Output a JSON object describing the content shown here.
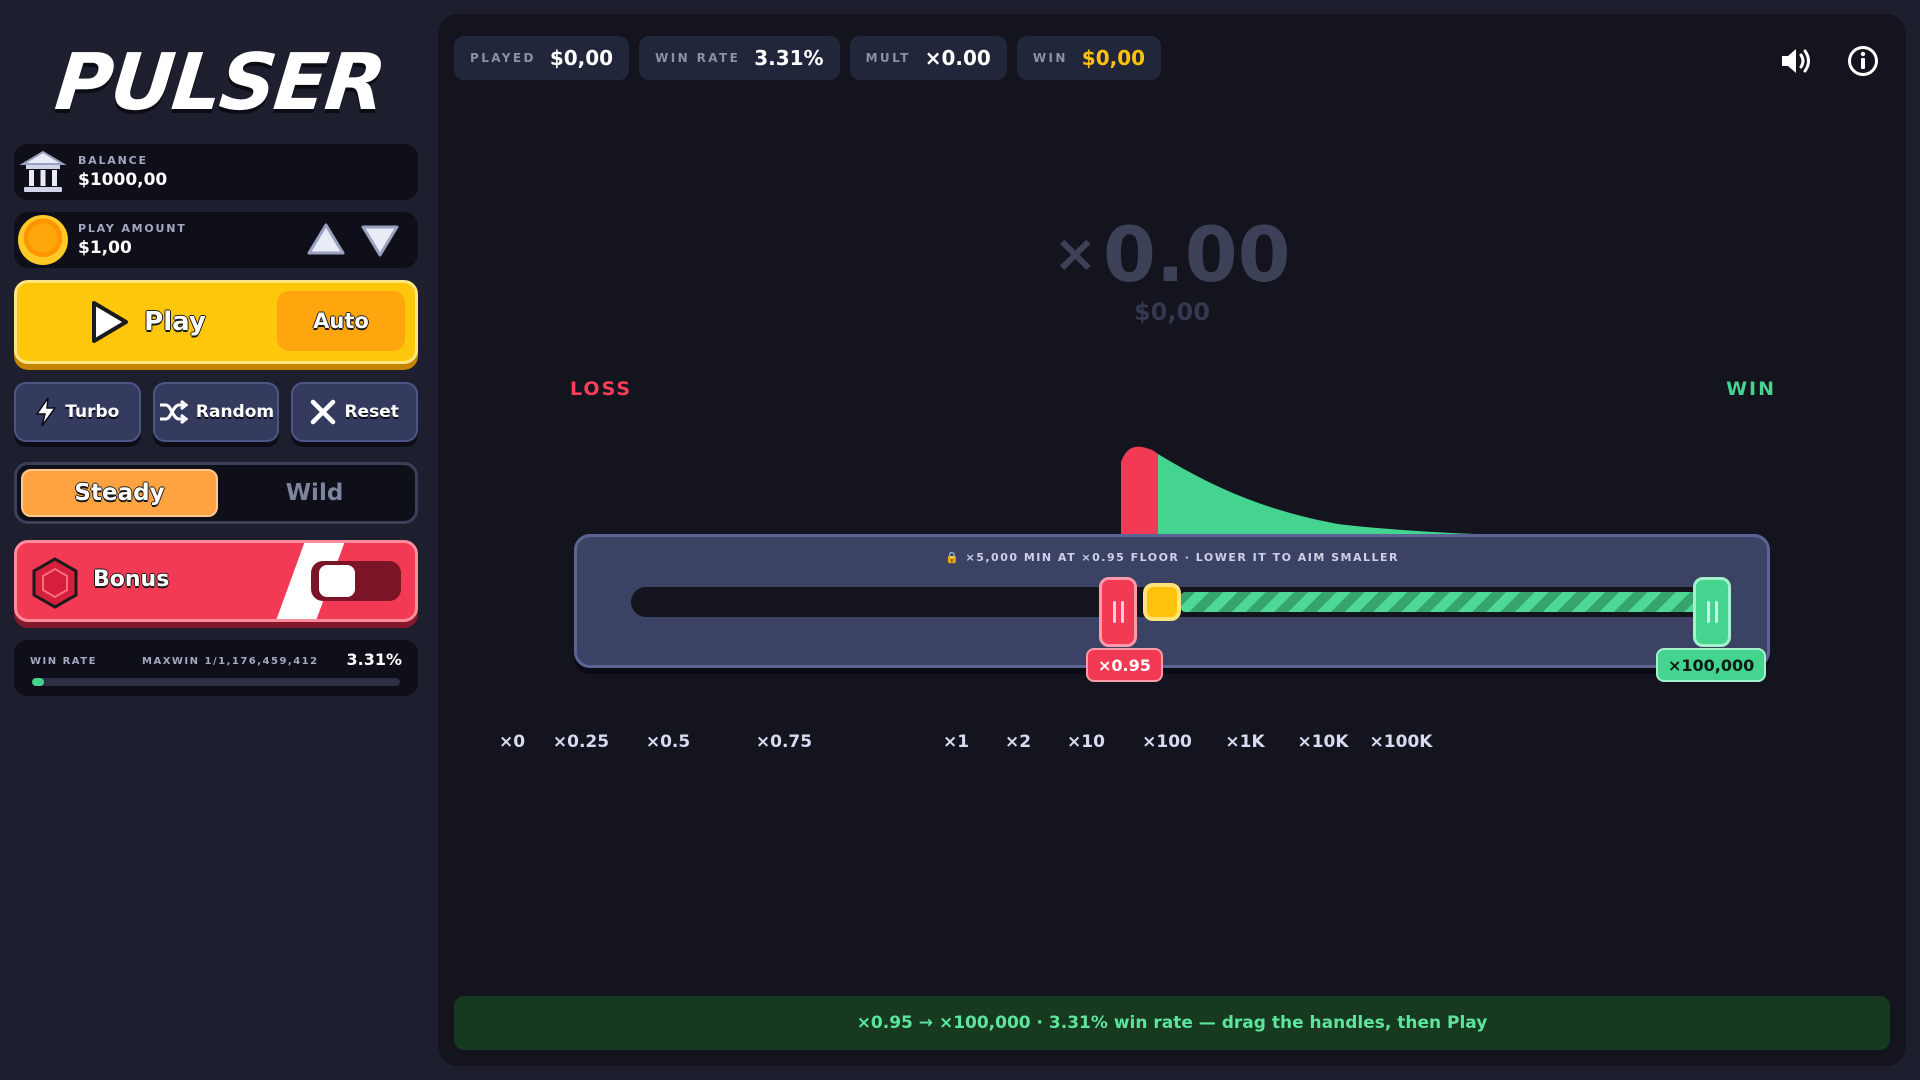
{
  "brand": {
    "logo": "PULSER"
  },
  "balance": {
    "label": "BALANCE",
    "value": "$1000,00"
  },
  "play_amount": {
    "label": "PLAY AMOUNT",
    "value": "$1,00"
  },
  "actions": {
    "play": "Play",
    "auto": "Auto"
  },
  "utilities": {
    "turbo": "Turbo",
    "random": "Random",
    "reset": "Reset"
  },
  "modes": {
    "steady": "Steady",
    "wild": "Wild",
    "active": "Steady"
  },
  "bonus": {
    "label": "Bonus"
  },
  "stats": {
    "win_rate_label": "WIN RATE",
    "maxwin_label": "MAXWIN 1/1,176,459,412",
    "win_rate_value": "3.31%",
    "win_rate_fraction": 0.0331
  },
  "chips": [
    {
      "label": "PLAYED",
      "value": "$0,00"
    },
    {
      "label": "WIN RATE",
      "value": "3.31%"
    },
    {
      "label": "MULT",
      "value": "×0.00"
    },
    {
      "label": "WIN",
      "value": "$0,00"
    }
  ],
  "display": {
    "multiplier_prefix": "×",
    "multiplier": "0.00",
    "amount": "$0,00"
  },
  "labels": {
    "loss": "LOSS",
    "win": "WIN"
  },
  "track": {
    "hint": "🔒 ×5,000 MIN AT ×0.95 FLOOR · LOWER IT TO AIM SMALLER",
    "low_value": "×0.95",
    "high_value": "×100,000"
  },
  "ticks": [
    "×0",
    "×0.25",
    "×0.5",
    "×0.75",
    "×1",
    "×2",
    "×10",
    "×100",
    "×1K",
    "×10K",
    "×100K"
  ],
  "status": "×0.95 → ×100,000 · 3.31% win rate — drag the handles, then Play",
  "colors": {
    "gold": "#ffc20c",
    "loss": "#f23a55",
    "win": "#44d48f",
    "panel": "#0e0f18"
  },
  "icons": {
    "balance": "bank-icon",
    "amount": "coin-icon",
    "sound": "speaker-icon",
    "info": "info-icon"
  }
}
